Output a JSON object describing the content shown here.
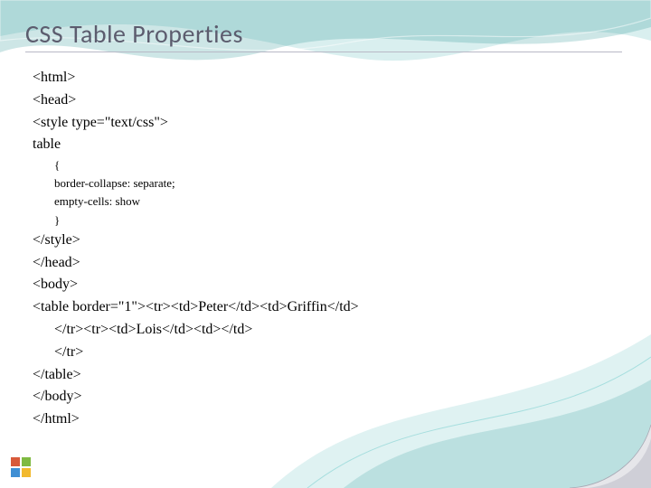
{
  "title": "CSS Table Properties",
  "code": {
    "l1": "<html>",
    "l2": "<head>",
    "l3": "<style type=\"text/css\">",
    "l4": "table",
    "l5": "{",
    "l6": "border-collapse: separate;",
    "l7": "empty-cells: show",
    "l8": "}",
    "l9": "</style>",
    "l10": "</head>",
    "l11": "<body>",
    "l12": "<table border=\"1\"><tr><td>Peter</td><td>Griffin</td>",
    "l13": "</tr><tr><td>Lois</td><td></td>",
    "l14": "</tr>",
    "l15": "</table>",
    "l16": "</body>",
    "l17": "</html>"
  }
}
